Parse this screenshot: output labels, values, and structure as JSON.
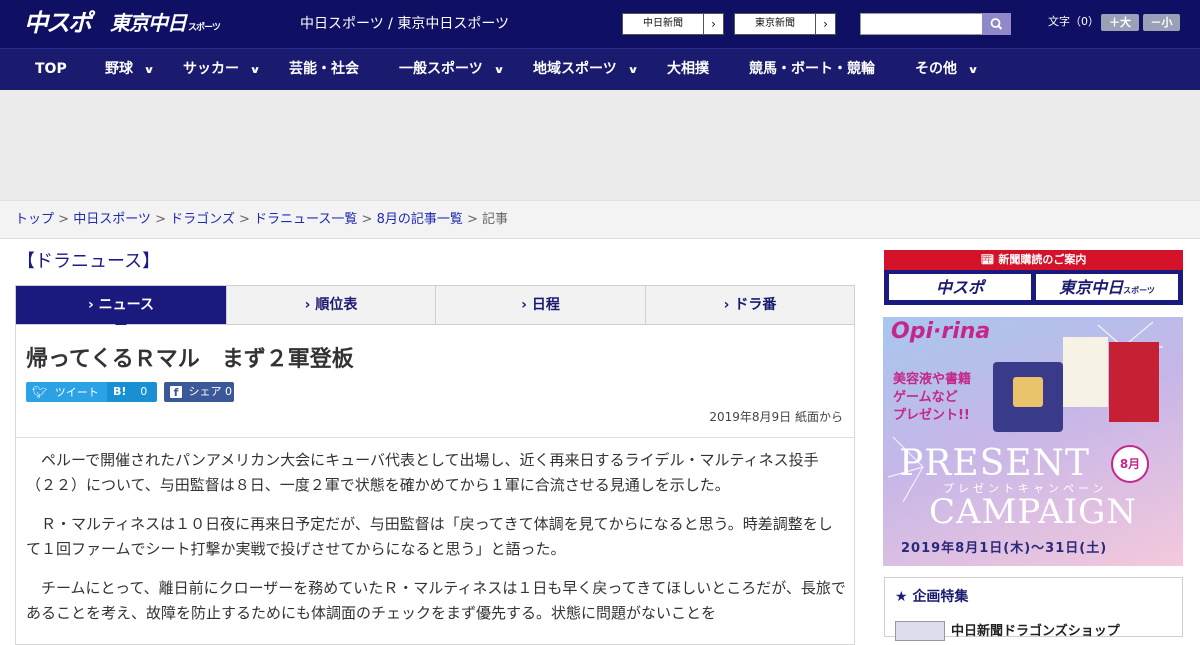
{
  "header": {
    "logo_main": "中スポ",
    "logo_tokyo": "東京中日",
    "logo_tokyo_small": "スポーツ",
    "site_name": "中日スポーツ / 東京中日スポーツ",
    "ext_links": [
      {
        "label": "中日新聞"
      },
      {
        "label": "東京新聞"
      }
    ],
    "font_size_label": "文字（0）",
    "font_up": "＋大",
    "font_down": "－小"
  },
  "nav": {
    "items": [
      {
        "label": "TOP"
      },
      {
        "label": "野球"
      },
      {
        "label": "サッカー"
      },
      {
        "label": "芸能・社会"
      },
      {
        "label": "一般スポーツ"
      },
      {
        "label": "地域スポーツ"
      },
      {
        "label": "大相撲"
      },
      {
        "label": "競馬・ボート・競輪"
      },
      {
        "label": "その他"
      }
    ]
  },
  "breadcrumb": {
    "items": [
      "トップ",
      "中日スポーツ",
      "ドラゴンズ",
      "ドラニュース一覧",
      "8月の記事一覧"
    ],
    "current": "記事",
    "sep": " > "
  },
  "section_title": "【ドラニュース】",
  "tabs": [
    {
      "label": "ニュース"
    },
    {
      "label": "順位表"
    },
    {
      "label": "日程"
    },
    {
      "label": "ドラ番"
    }
  ],
  "article": {
    "headline": "帰ってくるＲマル　まず２軍登板",
    "share": {
      "tweet": "ツイート",
      "hatena_count": "0",
      "facebook": "シェア 0"
    },
    "date": "2019年8月9日 紙面から",
    "paragraphs": [
      "ペルーで開催されたパンアメリカン大会にキューバ代表として出場し、近く再来日するライデル・マルティネス投手（２２）について、与田監督は８日、一度２軍で状態を確かめてから１軍に合流させる見通しを示した。",
      "Ｒ・マルティネスは１０日夜に再来日予定だが、与田監督は「戻ってきて体調を見てからになると思う。時差調整をして１回ファームでシート打撃か実戦で投げさせてからになると思う」と語った。",
      "チームにとって、離日前にクローザーを務めていたＲ・マルティネスは１日も早く戻ってきてほしいところだが、長旅であることを考え、故障を防止するためにも体調面のチェックをまず優先する。状態に問題がないことを"
    ]
  },
  "sidebar": {
    "promo_title": "新聞購読のご案内",
    "promo_left": "中スポ",
    "promo_right": "東京中日",
    "promo_right_small": "スポーツ",
    "banner": {
      "brand": "Opi·rina",
      "gifts": "美容液や書籍\nゲームなど\nプレゼント!!",
      "title1": "PRESENT",
      "title_sub": "プレゼントキャンペーン",
      "title2": "CAMPAIGN",
      "month": "8月",
      "period": "2019年8月1日(木)〜31日(土)"
    },
    "kikaku_title": "企画特集",
    "kikaku_item": "中日新聞ドラゴンズショップ"
  }
}
